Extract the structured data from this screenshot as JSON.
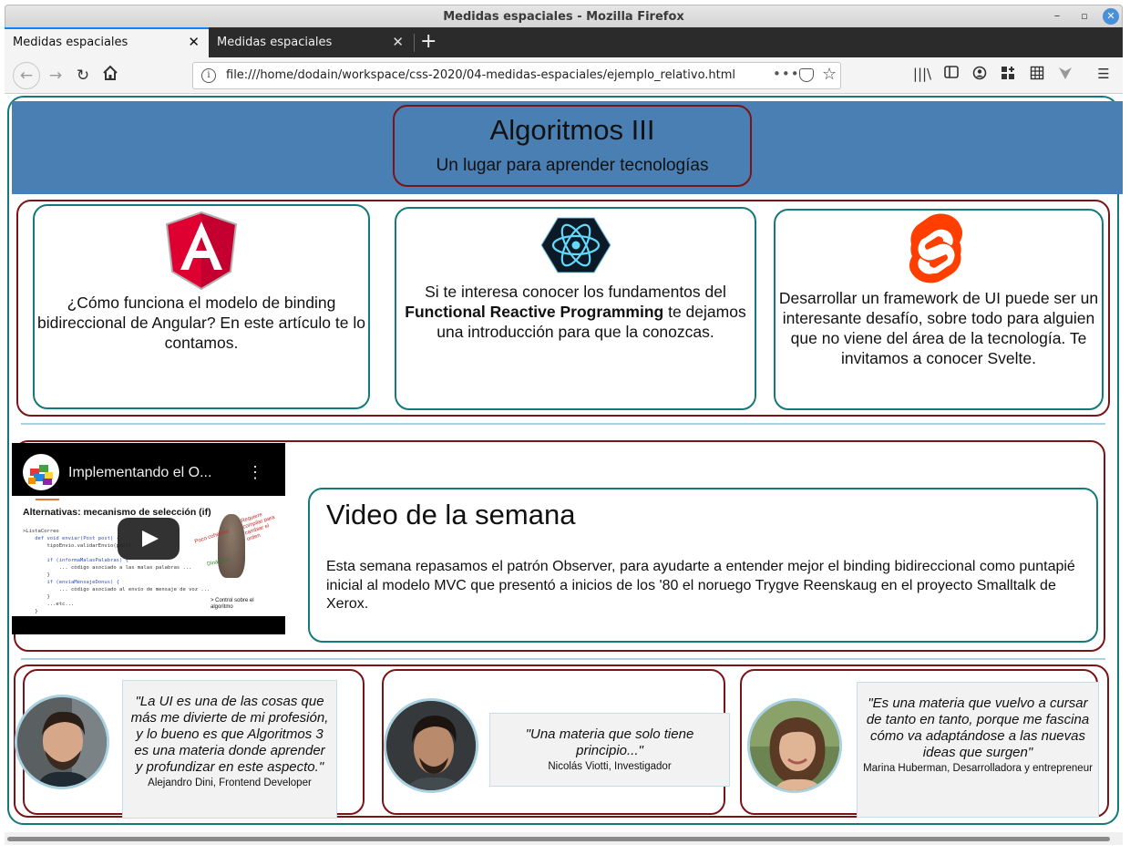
{
  "window": {
    "title": "Medidas espaciales - Mozilla Firefox"
  },
  "tabs": [
    {
      "label": "Medidas espaciales",
      "active": true
    },
    {
      "label": "Medidas espaciales",
      "active": false
    }
  ],
  "navbar": {
    "url": "file:///home/dodain/workspace/css-2020/04-medidas-espaciales/ejemplo_relativo.html",
    "icons": [
      "back-icon",
      "forward-icon",
      "reload-icon",
      "home-icon",
      "page-actions-icon",
      "pocket-icon",
      "bookmark-star-icon",
      "library-icon",
      "sidebar-icon",
      "account-icon",
      "extensions-icon",
      "grid-icon",
      "vpn-icon",
      "menu-icon"
    ]
  },
  "header": {
    "title": "Algoritmos III",
    "subtitle": "Un lugar para aprender tecnologías",
    "bg_color": "#4a7fb3"
  },
  "cards": [
    {
      "logo": "angular-logo",
      "text": "¿Cómo funciona el modelo de binding bidireccional de Angular? En este artículo te lo contamos."
    },
    {
      "logo": "react-logo",
      "text_before": "Si te interesa conocer los fundamentos del ",
      "text_bold": "Functional Reactive Programming",
      "text_after": " te dejamos una introducción para que la conozcas."
    },
    {
      "logo": "svelte-logo",
      "text": "Desarrollar un framework de UI puede ser un interesante desafío, sobre todo para alguien que no viene del área de la tecnología. Te invitamos a conocer Svelte."
    }
  ],
  "video": {
    "embed_title": "Implementando el O...",
    "slide_title": "Alternativas: mecanismo de selección (if)",
    "slide_code": [
      ">ListaCorreo",
      "    def void enviar(Post post) {",
      "        tipoEnvio.validarEnvio(post)",
      "        if (informaMalasPalabras) {",
      "            ... código asociado a las malas palabras ...",
      "        }",
      "        if (enviaMensajeDonus) {",
      "            ... código asociado al envío de mensaje de voz ...",
      "        }",
      "        ...etc...",
      "    }"
    ],
    "slide_label_red": "Requiere compilar para cambiar el orden",
    "slide_label_cohesion": "Poco cohesivo",
    "slide_label_dynamic": "Dinámico",
    "slide_label_control": "> Control sobre el algoritmo",
    "heading": "Video de la semana",
    "text": "Esta semana repasamos el patrón Observer, para ayudarte a entender mejor el binding bidireccional como puntapié inicial al modelo MVC que presentó a inicios de los '80 el noruego Trygve Reenskaug en el proyecto Smalltalk de Xerox."
  },
  "testimonials": [
    {
      "quote": "\"La UI es una de las cosas que más me divierte de mi profesión, y lo bueno es que Algoritmos 3 es una materia donde aprender y profundizar en este aspecto.\"",
      "author": "Alejandro Dini, Frontend Developer"
    },
    {
      "quote": "\"Una materia que solo tiene principio...\"",
      "author": "Nicolás Viotti, Investigador"
    },
    {
      "quote": "\"Es una materia que vuelvo a cursar de tanto en tanto, porque me fascina cómo va adaptándose a las nuevas ideas que surgen\"",
      "author": "Marina Huberman, Desarrolladora y entrepreneur"
    }
  ],
  "colors": {
    "teal_border": "#14797a",
    "maroon_border": "#7a1418",
    "divider": "#a9d1df"
  }
}
